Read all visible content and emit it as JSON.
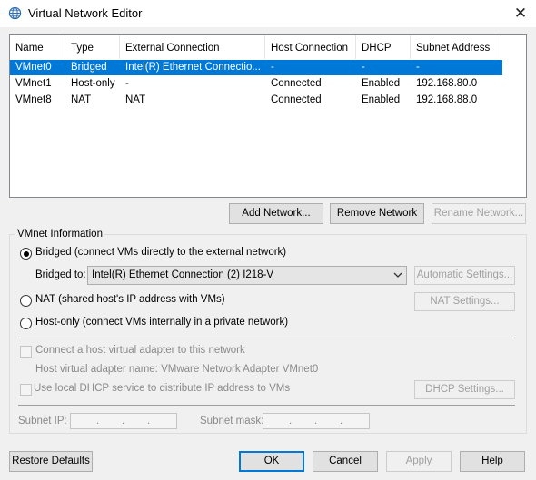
{
  "window": {
    "title": "Virtual Network Editor",
    "close_glyph": "✕",
    "icon": "globe-icon"
  },
  "table": {
    "columns": [
      "Name",
      "Type",
      "External Connection",
      "Host Connection",
      "DHCP",
      "Subnet Address"
    ],
    "rows": [
      {
        "name": "VMnet0",
        "type": "Bridged",
        "external": "Intel(R) Ethernet Connectio...",
        "host": "-",
        "dhcp": "-",
        "subnet": "-"
      },
      {
        "name": "VMnet1",
        "type": "Host-only",
        "external": "-",
        "host": "Connected",
        "dhcp": "Enabled",
        "subnet": "192.168.80.0"
      },
      {
        "name": "VMnet8",
        "type": "NAT",
        "external": "NAT",
        "host": "Connected",
        "dhcp": "Enabled",
        "subnet": "192.168.88.0"
      }
    ],
    "selected_row": "VMnet0"
  },
  "network_buttons": {
    "add": "Add Network...",
    "remove": "Remove Network",
    "rename": "Rename Network..."
  },
  "info": {
    "group_label": "VMnet Information",
    "bridged_label": "Bridged (connect VMs directly to the external network)",
    "bridged_to_label": "Bridged to:",
    "bridged_to_value": "Intel(R) Ethernet Connection (2) I218-V",
    "automatic_settings": "Automatic Settings...",
    "nat_label": "NAT (shared host's IP address with VMs)",
    "nat_settings": "NAT Settings...",
    "hostonly_label": "Host-only (connect VMs internally in a private network)",
    "selected_mode": "bridged",
    "connect_adapter_label": "Connect a host virtual adapter to this network",
    "adapter_name_label": "Host virtual adapter name: VMware Network Adapter VMnet0",
    "dhcp_label": "Use local DHCP service to distribute IP address to VMs",
    "dhcp_settings": "DHCP Settings...",
    "subnet_ip_label": "Subnet IP:",
    "subnet_mask_label": "Subnet mask:",
    "ip_dot": "."
  },
  "footer": {
    "restore": "Restore Defaults",
    "ok": "OK",
    "cancel": "Cancel",
    "apply": "Apply",
    "help": "Help"
  },
  "colors": {
    "selection": "#0078d7",
    "disabled_text": "#a0a0a0",
    "background": "#f0f0f0"
  }
}
